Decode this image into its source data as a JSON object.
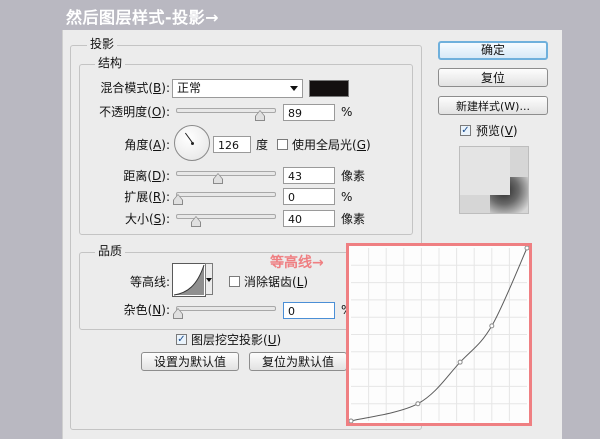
{
  "heading": "然后图层样式-投影→",
  "panel": {
    "title": "投影",
    "structure": {
      "title": "结构",
      "blend_mode": {
        "label": "混合模式",
        "hotkey": "B",
        "value": "正常",
        "color": "#141010"
      },
      "opacity": {
        "label": "不透明度",
        "hotkey": "O",
        "value": "89",
        "unit": "%",
        "level_pct": 89
      },
      "angle": {
        "label": "角度",
        "hotkey": "A",
        "value": "126",
        "unit": "度",
        "degrees": 126
      },
      "global_light": {
        "label": "使用全局光",
        "hotkey": "G",
        "checked": false
      },
      "distance": {
        "label": "距离",
        "hotkey": "D",
        "value": "43",
        "unit": "像素",
        "level_pct": 36
      },
      "spread": {
        "label": "扩展",
        "hotkey": "R",
        "value": "0",
        "unit": "%",
        "level_pct": 0
      },
      "size": {
        "label": "大小",
        "hotkey": "S",
        "value": "40",
        "unit": "像素",
        "level_pct": 17
      }
    },
    "quality": {
      "title": "品质",
      "contour": {
        "label": "等高线",
        "icon": "contour-curve-icon"
      },
      "anti_alias": {
        "label": "消除锯齿",
        "hotkey": "L",
        "checked": false
      },
      "noise": {
        "label": "杂色",
        "hotkey": "N",
        "value": "0",
        "unit": "%",
        "level_pct": 0
      }
    },
    "knockout": {
      "label": "图层挖空投影",
      "hotkey": "U",
      "checked": true
    },
    "set_default": "设置为默认值",
    "reset_default": "复位为默认值"
  },
  "buttons": {
    "ok": "确定",
    "reset": "复位",
    "new_style": "新建样式(W)...",
    "preview_label": "预览",
    "preview_hotkey": "V",
    "preview_checked": true
  },
  "annotation": {
    "label": "等高线→",
    "color": "#ef7f82",
    "curve_points": [
      [
        0.0,
        0.0
      ],
      [
        0.38,
        0.1
      ],
      [
        0.62,
        0.34
      ],
      [
        0.8,
        0.55
      ],
      [
        1.0,
        1.0
      ]
    ]
  }
}
